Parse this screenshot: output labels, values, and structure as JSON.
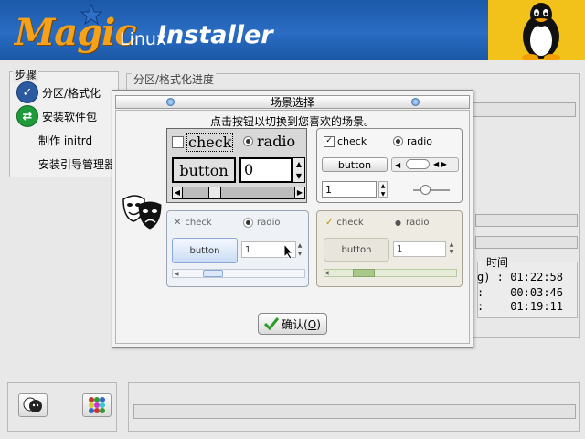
{
  "banner": {
    "logo_magic": "Magic",
    "logo_linux": "Linux",
    "logo_installer": "Installer"
  },
  "steps": {
    "title": "步骤",
    "items": [
      {
        "label": "分区/格式化",
        "icon": "check-circle-icon",
        "color": "#2c5aa0"
      },
      {
        "label": "安装软件包",
        "icon": "swap-arrows-icon",
        "color": "#1e9a3a"
      },
      {
        "label": "制作 initrd",
        "icon": "",
        "color": ""
      },
      {
        "label": "安装引导管理器",
        "icon": "",
        "color": ""
      }
    ]
  },
  "main": {
    "title": "分区/格式化进度",
    "time_title": "时间",
    "times": [
      {
        "key": "g) :",
        "value": "01:22:58"
      },
      {
        "key": ":",
        "value": "00:03:46"
      },
      {
        "key": ":",
        "value": "01:19:11"
      }
    ]
  },
  "dialog": {
    "title": "场景选择",
    "subtitle": "点击按钮以切换到您喜欢的场景。",
    "ok_label": "确认(O)",
    "ok_underline": "O",
    "themes": [
      {
        "check": "check",
        "radio": "radio",
        "button": "button",
        "spin": "0"
      },
      {
        "check": "check",
        "radio": "radio",
        "button": "button",
        "spin": "1"
      },
      {
        "check": "check",
        "radio": "radio",
        "button": "button",
        "spin": "1"
      },
      {
        "check": "check",
        "radio": "radio",
        "button": "button",
        "spin": "1"
      }
    ]
  },
  "colors": {
    "banner_blue": "#1f5fb0",
    "logo_orange": "#f5a21a",
    "tux_bg": "#f2c21a"
  }
}
